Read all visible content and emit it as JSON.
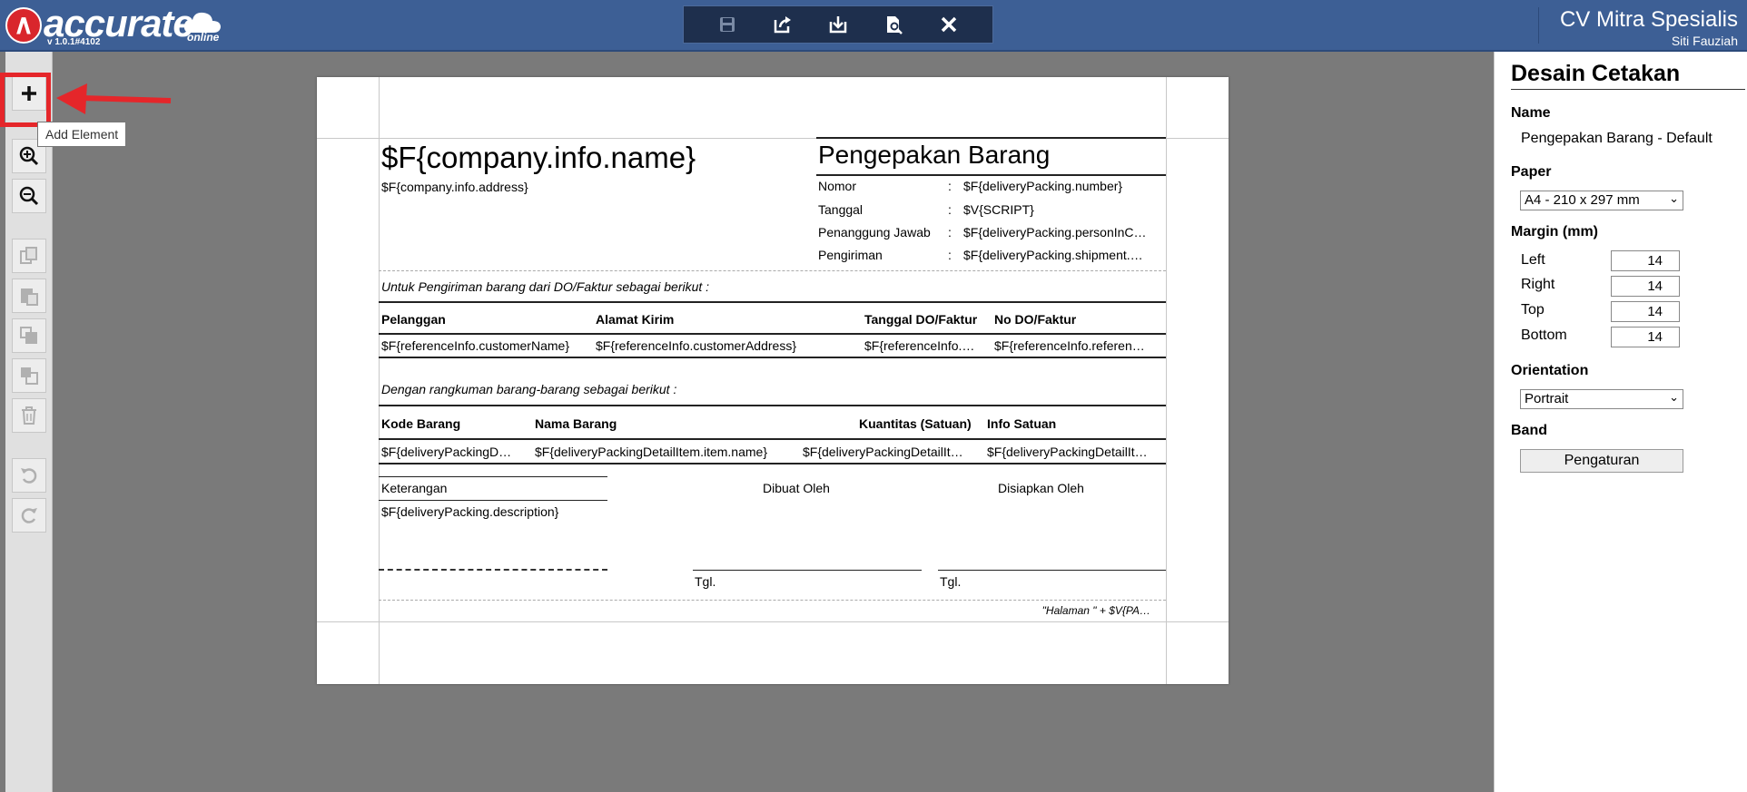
{
  "header": {
    "logo_text": "accurate",
    "logo_online": "online",
    "version": "v 1.0.1#4102",
    "company_name": "CV Mitra Spesialis",
    "user_name": "Siti Fauziah"
  },
  "toolbar": {
    "icons": [
      "save-icon",
      "export-icon",
      "import-icon",
      "preview-icon",
      "close-icon"
    ]
  },
  "left_toolbar": {
    "tooltip": "Add Element"
  },
  "design": {
    "company_name": "$F{company.info.name}",
    "company_address": "$F{company.info.address}",
    "doc_title": "Pengepakan Barang",
    "fields": [
      {
        "label": "Nomor",
        "sep": ":",
        "value": "$F{deliveryPacking.number}"
      },
      {
        "label": "Tanggal",
        "sep": ":",
        "value": "$V{SCRIPT}"
      },
      {
        "label": "Penanggung Jawab",
        "sep": ":",
        "value": "$F{deliveryPacking.personInC…"
      },
      {
        "label": "Pengiriman",
        "sep": ":",
        "value": "$F{deliveryPacking.shipment.…"
      }
    ],
    "intro1": "Untuk Pengiriman barang dari DO/Faktur sebagai berikut :",
    "ref_headers": [
      "Pelanggan",
      "Alamat Kirim",
      "Tanggal DO/Faktur",
      "No DO/Faktur"
    ],
    "ref_values": [
      "$F{referenceInfo.customerName}",
      "$F{referenceInfo.customerAddress}",
      "$F{referenceInfo.…",
      "$F{referenceInfo.referen…"
    ],
    "intro2": "Dengan rangkuman barang-barang sebagai berikut :",
    "item_headers": [
      "Kode Barang",
      "Nama Barang",
      "Kuantitas (Satuan)",
      "Info Satuan"
    ],
    "item_values": [
      "$F{deliveryPackingD…",
      "$F{deliveryPackingDetailItem.item.name}",
      "$F{deliveryPackingDetailIt…",
      "$F{deliveryPackingDetailIt…"
    ],
    "notes_label": "Keterangan",
    "notes_value": "$F{deliveryPacking.description}",
    "made_by": "Dibuat Oleh",
    "prepared_by": "Disiapkan Oleh",
    "tgl1": "Tgl.",
    "tgl2": "Tgl.",
    "page_footer": "\"Halaman \" +  $V{PA…"
  },
  "panel": {
    "title": "Desain Cetakan",
    "name_label": "Name",
    "name_value": "Pengepakan Barang - Default",
    "paper_label": "Paper",
    "paper_value": "A4 - 210 x 297 mm",
    "margin_label": "Margin (mm)",
    "margins": [
      {
        "label": "Left",
        "value": "14"
      },
      {
        "label": "Right",
        "value": "14"
      },
      {
        "label": "Top",
        "value": "14"
      },
      {
        "label": "Bottom",
        "value": "14"
      }
    ],
    "orientation_label": "Orientation",
    "orientation_value": "Portrait",
    "band_label": "Band",
    "band_button": "Pengaturan"
  }
}
